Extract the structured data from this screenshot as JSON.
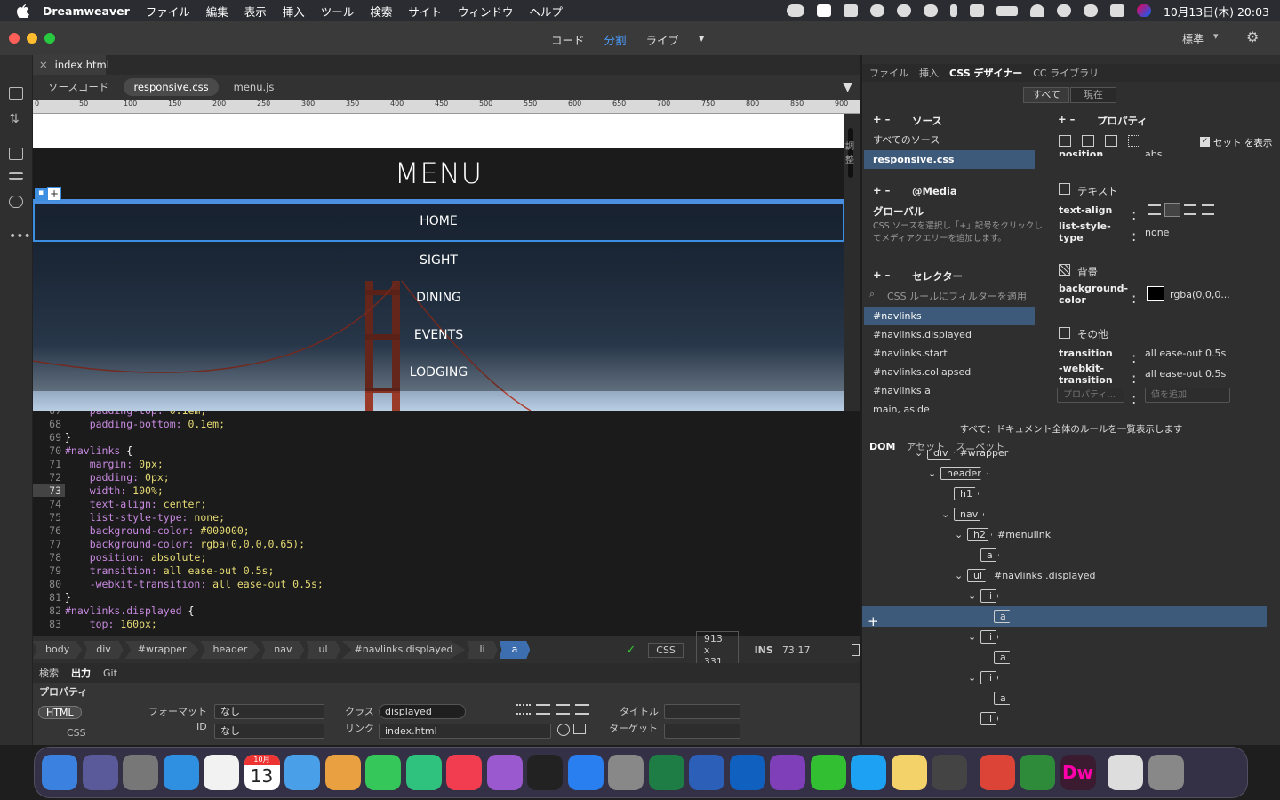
{
  "menubar": {
    "app": "Dreamweaver",
    "items": [
      "ファイル",
      "編集",
      "表示",
      "挿入",
      "ツール",
      "検索",
      "サイト",
      "ウィンドウ",
      "ヘルプ"
    ],
    "clock": "10月13日(木) 20:03"
  },
  "titlebar": {
    "views": [
      "コード",
      "分割",
      "ライブ"
    ],
    "active_view": "分割",
    "workspace": "標準"
  },
  "doc": {
    "tab": "index.html",
    "files": [
      "ソースコード",
      "responsive.css",
      "menu.js"
    ],
    "active_file": "responsive.css"
  },
  "ruler": [
    "0",
    "50",
    "100",
    "150",
    "200",
    "250",
    "300",
    "350",
    "400",
    "450",
    "500",
    "550",
    "600",
    "650",
    "700",
    "750",
    "800",
    "850",
    "900"
  ],
  "live": {
    "menu_title": "MENU",
    "nav": [
      "HOME",
      "SIGHT",
      "DINING",
      "EVENTS",
      "LODGING"
    ],
    "side_label": "調整"
  },
  "code": [
    {
      "n": "67",
      "t": "    padding-top: 0.1em;"
    },
    {
      "n": "68",
      "t": "    padding-bottom: 0.1em;"
    },
    {
      "n": "69",
      "t": "}"
    },
    {
      "n": "70",
      "t": "#navlinks {"
    },
    {
      "n": "71",
      "t": "    margin: 0px;"
    },
    {
      "n": "72",
      "t": "    padding: 0px;"
    },
    {
      "n": "73",
      "t": "    width: 100%;"
    },
    {
      "n": "74",
      "t": "    text-align: center;"
    },
    {
      "n": "75",
      "t": "    list-style-type: none;"
    },
    {
      "n": "76",
      "t": "    background-color: #000000;"
    },
    {
      "n": "77",
      "t": "    background-color: rgba(0,0,0,0.65);"
    },
    {
      "n": "78",
      "t": "    position: absolute;"
    },
    {
      "n": "79",
      "t": "    transition: all ease-out 0.5s;"
    },
    {
      "n": "80",
      "t": "    -webkit-transition: all ease-out 0.5s;"
    },
    {
      "n": "81",
      "t": "}"
    },
    {
      "n": "82",
      "t": "#navlinks.displayed {"
    },
    {
      "n": "83",
      "t": "    top: 160px;"
    }
  ],
  "tagbar": {
    "tags": [
      "body",
      "div",
      "#wrapper",
      "header",
      "nav",
      "ul",
      "#navlinks.displayed",
      "li",
      "a"
    ],
    "lang": "CSS",
    "size": "913 x 331",
    "mode": "INS",
    "pos": "73:17"
  },
  "output": {
    "tabs": [
      "検索",
      "出力",
      "Git"
    ],
    "active": "出力"
  },
  "props": {
    "title": "プロパティ",
    "html": "HTML",
    "css": "CSS",
    "format_label": "フォーマット",
    "format": "なし",
    "id_label": "ID",
    "id": "なし",
    "class_label": "クラス",
    "class": "displayed",
    "link_label": "リンク",
    "link": "index.html",
    "title_label": "タイトル",
    "target_label": "ターゲット"
  },
  "right": {
    "tabs": [
      "ファイル",
      "挿入",
      "CSS デザイナー",
      "CC ライブラリ"
    ],
    "active": "CSS デザイナー",
    "scope": [
      "すべて",
      "現在"
    ],
    "sources_head": "ソース",
    "sources": [
      "すべてのソース",
      "responsive.css"
    ],
    "media_head": "@Media",
    "media_global": "グローバル",
    "media_hint": "CSS ソースを選択し「+」記号をクリックしてメディアクエリーを追加します。",
    "selectors_head": "セレクター",
    "filter_ph": "CSS ルールにフィルターを適用",
    "selectors": [
      "#navlinks",
      "#navlinks.displayed",
      "#navlinks.start",
      "#navlinks.collapsed",
      "#navlinks a",
      "main, aside"
    ],
    "props_head": "プロパティ",
    "show_set": "セット を表示",
    "text_head": "テキスト",
    "text_align": "text-align",
    "list_style": "list-style-type",
    "list_style_val": "none",
    "bg_head": "背景",
    "bg_label": "background-color",
    "bg_val": "rgba(0,0,0...",
    "other_head": "その他",
    "transition": "transition",
    "transition_val": "all ease-out 0.5s",
    "wtransition": "-webkit-transition",
    "wtransition_val": "all ease-out 0.5s",
    "prop_ph": "プロパティ...",
    "val_ph": "値を追加",
    "position_partial": "position",
    "position_val": "abs...",
    "footer": "すべて：ドキュメント全体のルールを一覧表示します",
    "dom_tabs": [
      "DOM",
      "アセット",
      "スニペット"
    ],
    "dom": [
      {
        "d": 3,
        "tag": "div",
        "label": "#wrapper"
      },
      {
        "d": 4,
        "tag": "header",
        "label": ""
      },
      {
        "d": 5,
        "tag": "h1",
        "label": ""
      },
      {
        "d": 5,
        "tag": "nav",
        "label": ""
      },
      {
        "d": 6,
        "tag": "h2",
        "label": "#menulink"
      },
      {
        "d": 7,
        "tag": "a",
        "label": ""
      },
      {
        "d": 6,
        "tag": "ul",
        "label": "#navlinks .displayed"
      },
      {
        "d": 7,
        "tag": "li",
        "label": ""
      },
      {
        "d": 8,
        "tag": "a",
        "label": ""
      },
      {
        "d": 7,
        "tag": "li",
        "label": ""
      },
      {
        "d": 8,
        "tag": "a",
        "label": ""
      },
      {
        "d": 7,
        "tag": "li",
        "label": ""
      },
      {
        "d": 8,
        "tag": "a",
        "label": ""
      },
      {
        "d": 7,
        "tag": "li",
        "label": ""
      }
    ]
  },
  "dock": {
    "calendar_month": "10月",
    "calendar_day": "13",
    "dw": "Dw",
    "colors": [
      "#3b82e0",
      "#5a5a9a",
      "#777",
      "#2f8fe0",
      "#f2f2f2",
      "#eee",
      "#4aa0e8",
      "#e8a040",
      "#35c759",
      "#2ec27e",
      "#f23c50",
      "#9b59d0",
      "#222",
      "#2a7ff0",
      "#888",
      "#1e7d45",
      "#2b5fb8",
      "#1060c0",
      "#7f3fb8",
      "#32c032",
      "#1da1f2",
      "#f4d26a",
      "#444",
      "#db4437",
      "#2e8b3a",
      "#3a1b2f",
      "#ddd",
      "#888"
    ]
  }
}
